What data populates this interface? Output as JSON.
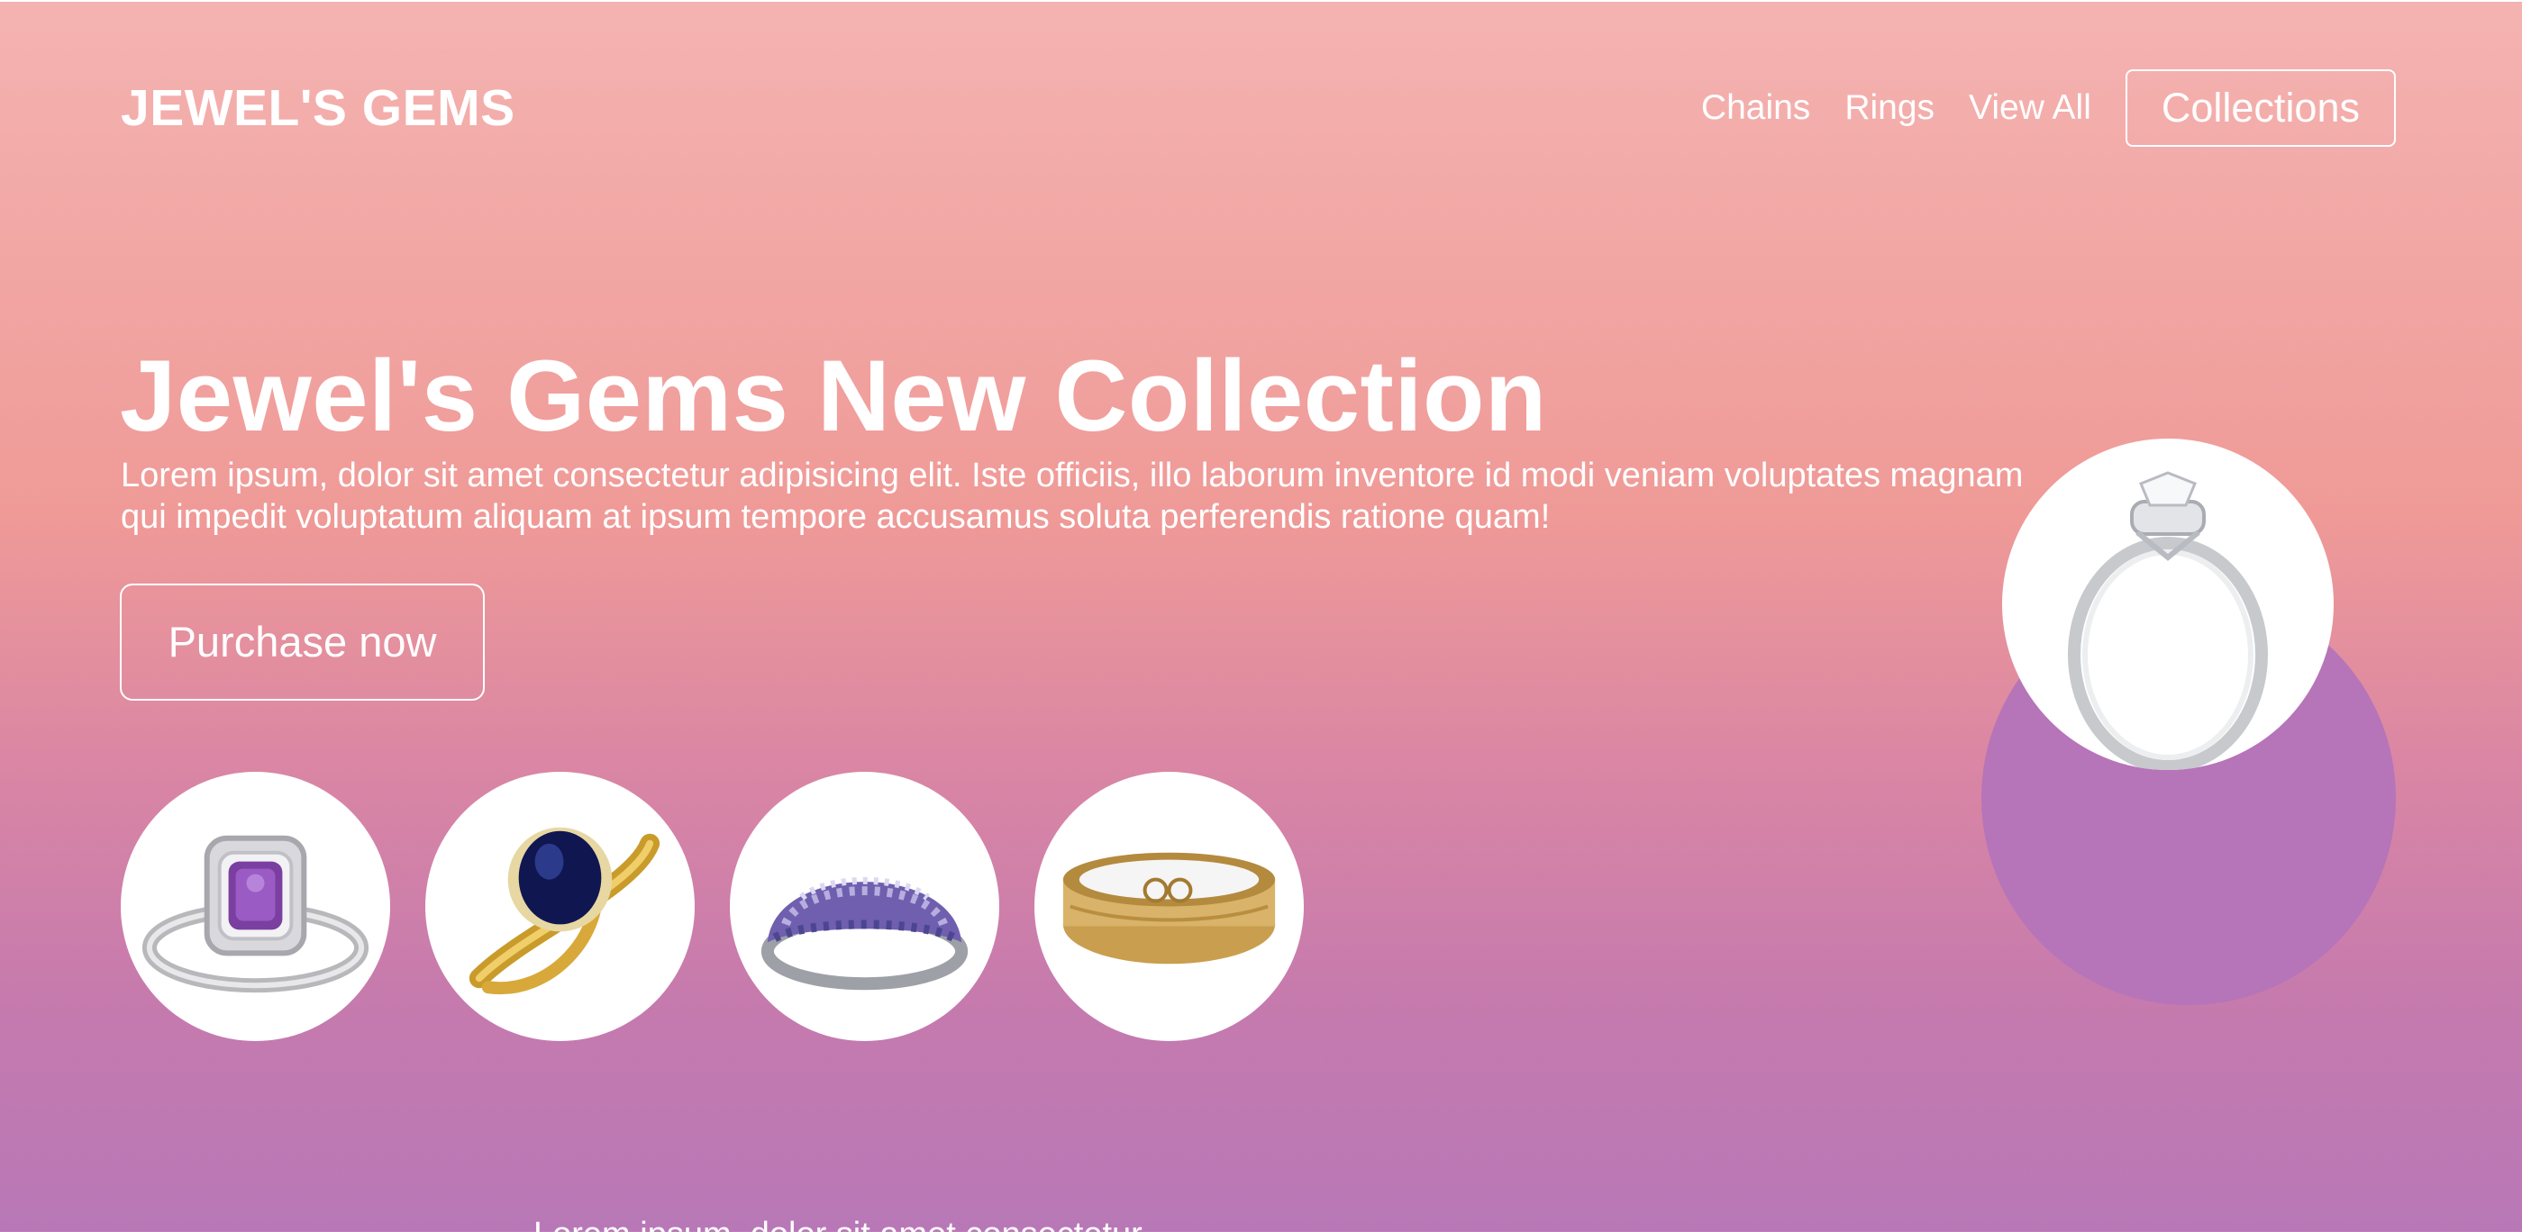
{
  "brand": {
    "name": "JEWEL'S GEMS"
  },
  "nav": {
    "links": [
      "Chains",
      "Rings",
      "View All"
    ],
    "button": "Collections"
  },
  "hero": {
    "title": "Jewel's Gems New Collection",
    "text": "Lorem ipsum, dolor sit amet consectetur adipisicing elit. Iste officiis, illo laborum inventore id modi veniam voluptates magnam qui impedit voluptatum aliquam at ipsum tempore accusamus soluta perferendis ratione quam!",
    "cta": "Purchase now"
  },
  "products": [
    {
      "icon": "amethyst-ring-icon"
    },
    {
      "icon": "sapphire-ring-icon"
    },
    {
      "icon": "crystal-band-ring-icon"
    },
    {
      "icon": "gold-band-ring-icon"
    }
  ],
  "featured": {
    "icon": "diamond-halo-ring-icon"
  },
  "bottom": {
    "text": "Lorem ipsum, dolor sit amet consectetur"
  },
  "colors": {
    "gradient_top": "#f4b3b1",
    "gradient_mid": "#ef9a97",
    "gradient_bottom": "#b878b7",
    "accent_purple": "#b674b9",
    "text": "#ffffff"
  }
}
